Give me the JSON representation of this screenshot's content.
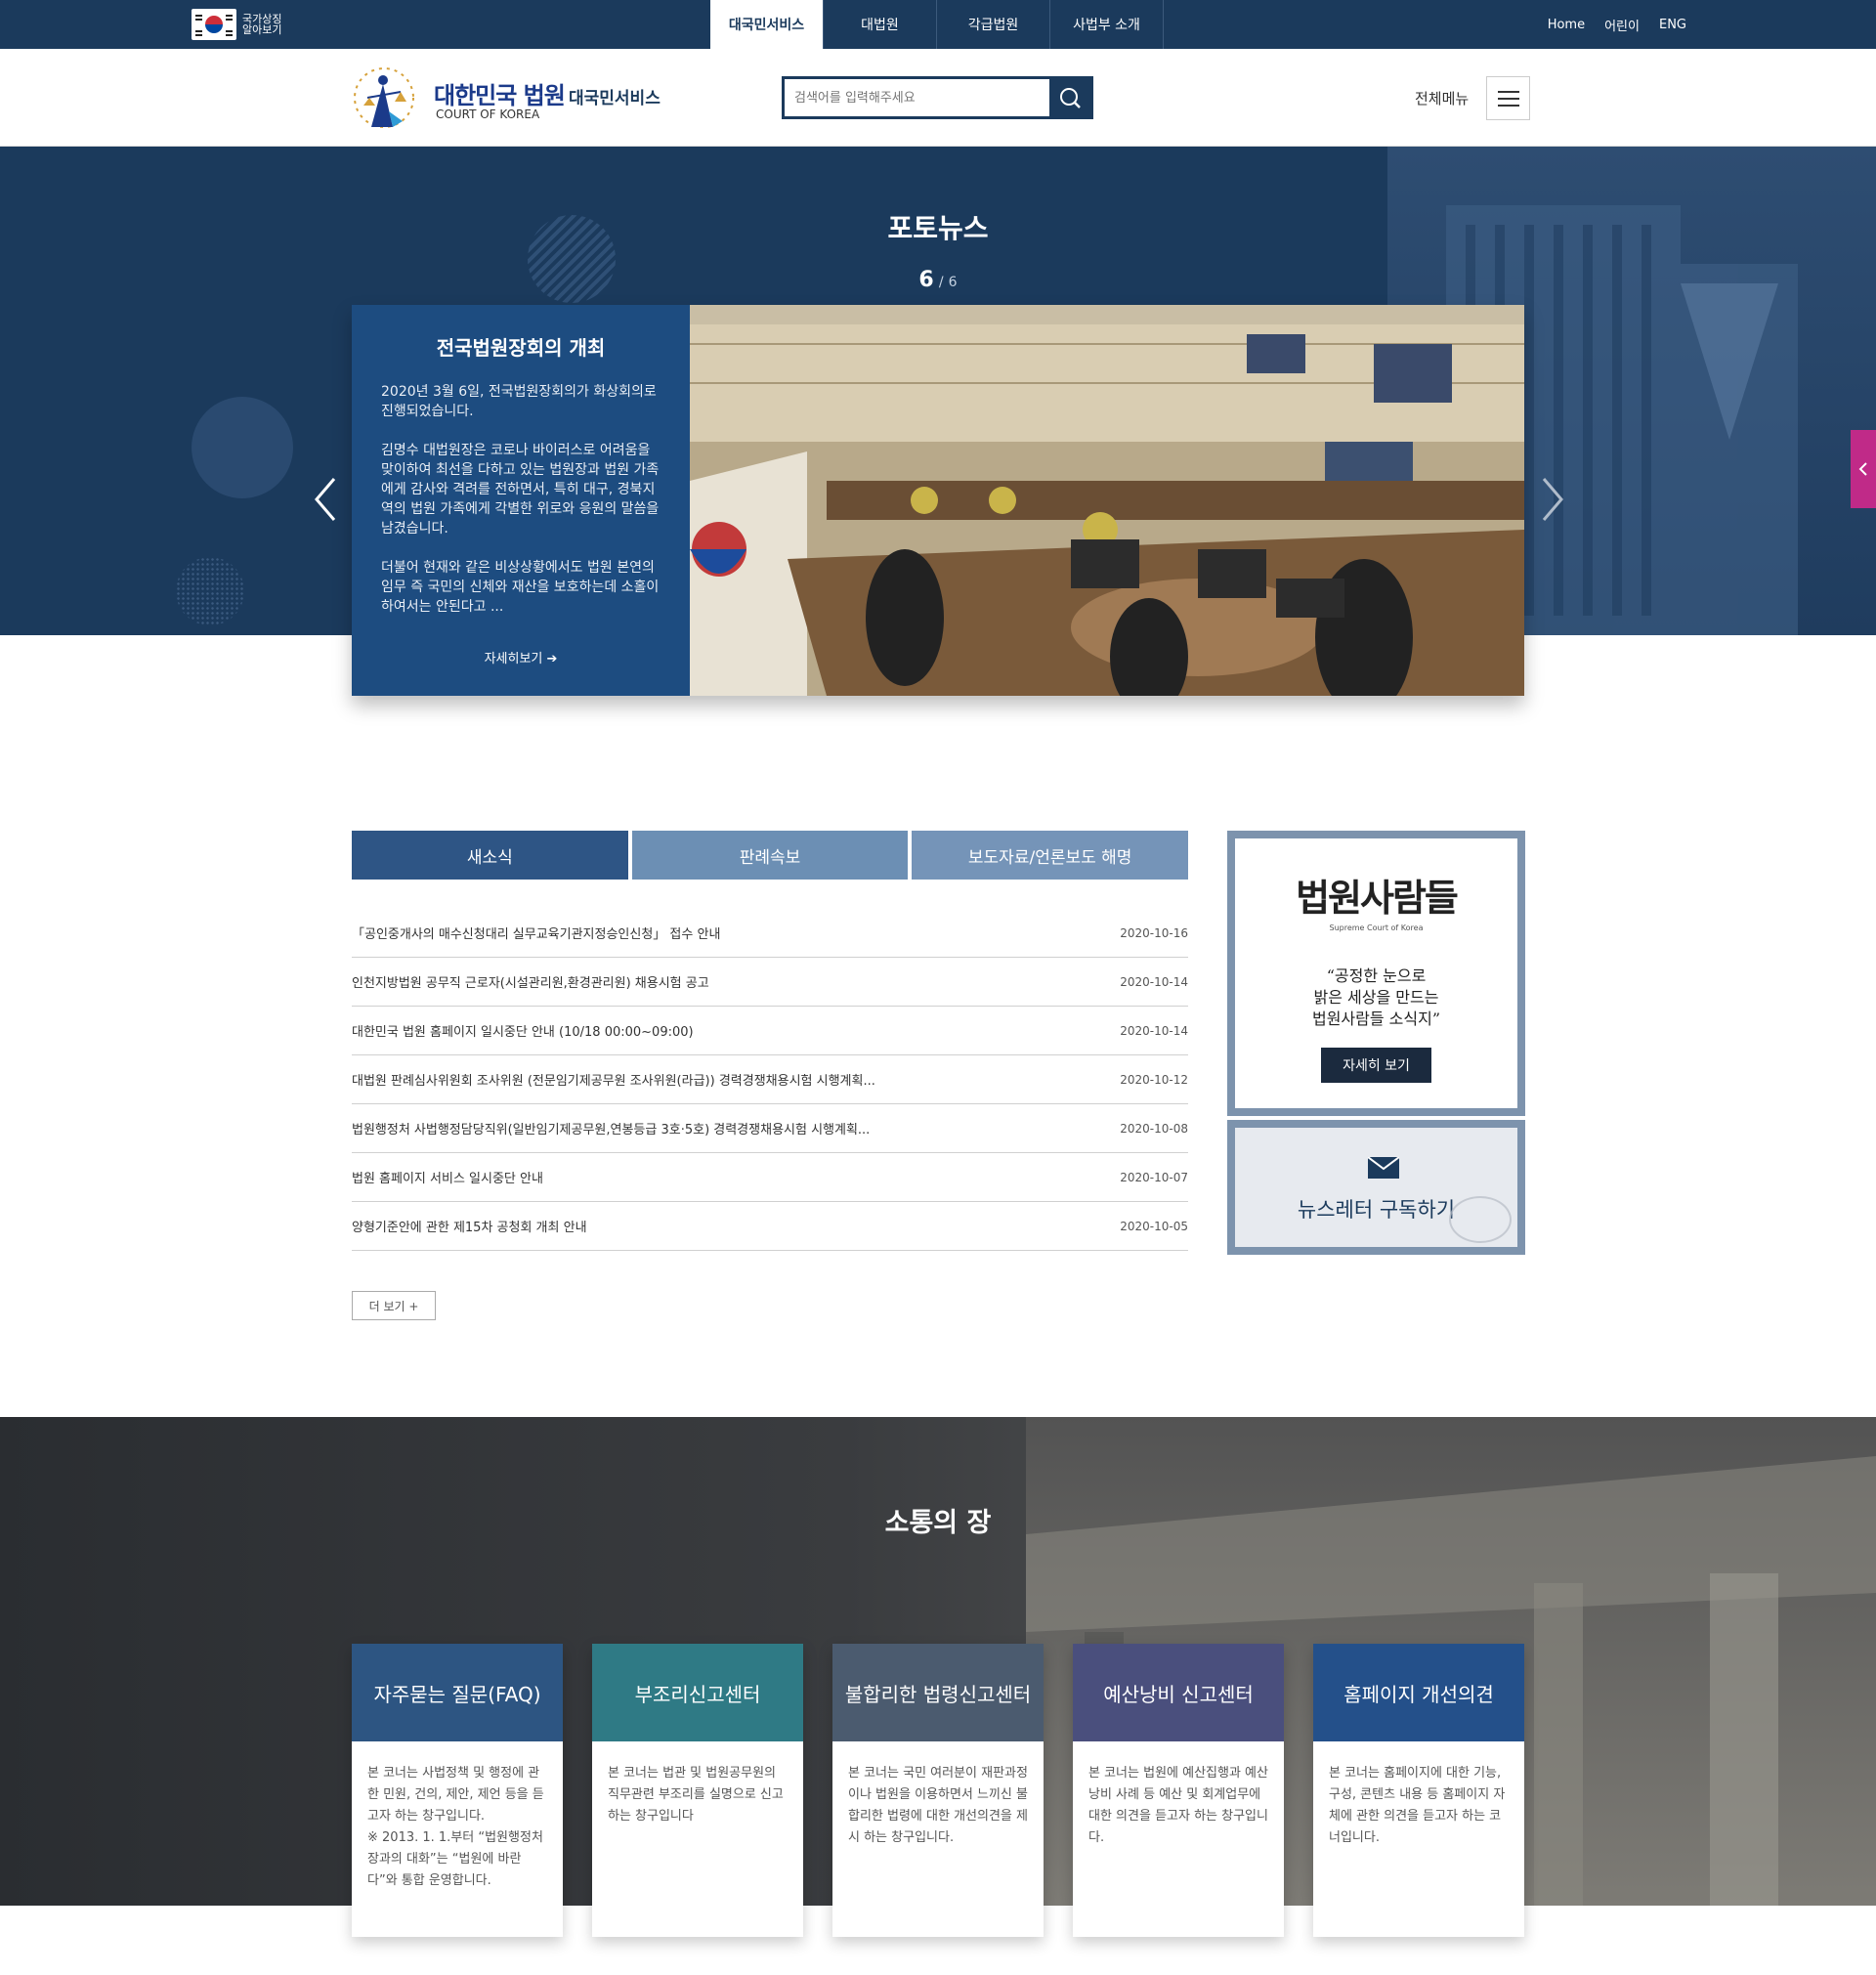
{
  "topbar": {
    "flag_label": "국가상징 알아보기",
    "gnb": [
      "대국민서비스",
      "대법원",
      "각급법원",
      "사법부 소개"
    ],
    "util": [
      "Home",
      "어린이",
      "ENG"
    ]
  },
  "header": {
    "logo_title": "대한민국 법원",
    "logo_sub": "대국민서비스",
    "logo_eng": "COURT OF KOREA",
    "search_placeholder": "검색어를 입력해주세요",
    "allmenu_label": "전체메뉴"
  },
  "hero": {
    "title": "포토뉴스",
    "current": "6",
    "separator": "/",
    "total": "6",
    "slide_title": "전국법원장회의 개최",
    "slide_body": "2020년 3월 6일, 전국법원장회의가 화상회의로 진행되었습니다.\n\n김명수 대법원장은 코로나 바이러스로 어려움을 맞이하여 최선을 다하고 있는 법원장과 법원 가족에게 감사와 격려를 전하면서, 특히 대구, 경북지역의 법원 가족에게 각별한 위로와 응원의 말씀을 남겼습니다.\n\n더불어 현재와 같은 비상상황에서도 법원 본연의 임무 즉 국민의 신체와 재산을 보호하는데 소홀이 하여서는 안된다고 ...",
    "slide_more": "자세히보기 ➔"
  },
  "news": {
    "tabs": [
      "새소식",
      "판례속보",
      "보도자료/언론보도 해명"
    ],
    "items": [
      {
        "title": "「공인중개사의 매수신청대리 실무교육기관지정승인신청」 접수 안내",
        "date": "2020-10-16"
      },
      {
        "title": "인천지방법원 공무직 근로자(시설관리원,환경관리원) 채용시험 공고",
        "date": "2020-10-14"
      },
      {
        "title": "대한민국 법원 홈페이지 일시중단 안내 (10/18 00:00~09:00)",
        "date": "2020-10-14"
      },
      {
        "title": "대법원 판례심사위원회 조사위원 (전문임기제공무원 조사위원(라급)) 경력경쟁채용시험 시행계획...",
        "date": "2020-10-12"
      },
      {
        "title": "법원행정처 사법행정담당직위(일반임기제공무원,연봉등급 3호·5호) 경력경쟁채용시험 시행계획...",
        "date": "2020-10-08"
      },
      {
        "title": "법원 홈페이지 서비스 일시중단 안내",
        "date": "2020-10-07"
      },
      {
        "title": "양형기준안에 관한 제15차 공청회 개최 안내",
        "date": "2020-10-05"
      }
    ],
    "more_label": "더 보기 +"
  },
  "promo": {
    "logo_text": "법원사람들",
    "logo_small": "Supreme Court of Korea",
    "quote": "“공정한 눈으로\n밝은 세상을 만드는\n법원사람들 소식지”",
    "button": "자세히 보기",
    "newsletter": "뉴스레터 구독하기"
  },
  "comm": {
    "title": "소통의 장",
    "cards": [
      {
        "title": "자주묻는 질문(FAQ)",
        "color": "#2d5582",
        "body": "본 코너는 사법정책 및 행정에 관한 민원, 건의, 제안, 제언 등을 듣고자 하는 창구입니다.\n※ 2013. 1. 1.부터 “법원행정처장과의 대화”는 “법원에 바란다”와 통합 운영합니다."
      },
      {
        "title": "부조리신고센터",
        "color": "#2f7a85",
        "body": "본 코너는 법관 및 법원공무원의 직무관련 부조리를 실명으로 신고하는 창구입니다"
      },
      {
        "title": "불합리한 법령신고센터",
        "color": "#4b5b6f",
        "body": "본 코너는 국민 여러분이 재판과정이나 법원을 이용하면서 느끼신 불합리한 법령에 대한 개선의견을 제시 하는 창구입니다."
      },
      {
        "title": "예산낭비 신고센터",
        "color": "#4a4f7d",
        "body": "본 코너는 법원에 예산집행과 예산낭비 사례 등 예산 및 회계업무에 대한 의견을 듣고자 하는 창구입니다."
      },
      {
        "title": "홈페이지 개선의견",
        "color": "#24508a",
        "body": "본 코너는 홈페이지에 대한 기능, 구성, 콘텐츠 내용 등 홈페이지 자체에 관한 의견을 듣고자 하는 코너입니다."
      }
    ]
  }
}
